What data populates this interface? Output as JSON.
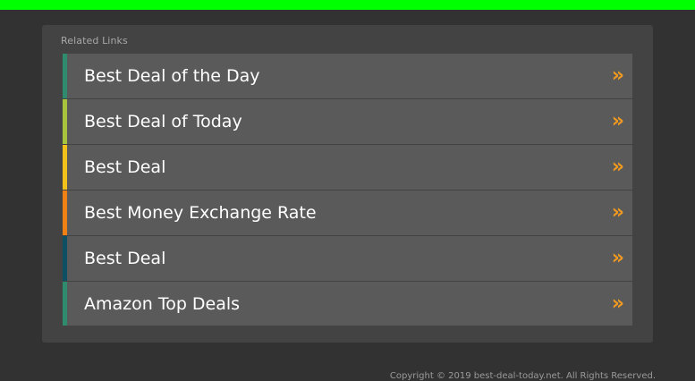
{
  "panel": {
    "title": "Related Links"
  },
  "links": [
    {
      "label": "Best Deal of the Day",
      "accent": "#2e8b6e"
    },
    {
      "label": "Best Deal of Today",
      "accent": "#a8c43c"
    },
    {
      "label": "Best Deal",
      "accent": "#f2c21b"
    },
    {
      "label": "Best Money Exchange Rate",
      "accent": "#f07f14"
    },
    {
      "label": "Best Deal",
      "accent": "#0d4f63"
    },
    {
      "label": "Amazon Top Deals",
      "accent": "#2e8b6e"
    }
  ],
  "arrow_glyph": "»",
  "arrow_icon": "double-chevron-right-icon",
  "colors": {
    "top_bar": "#00ff00",
    "background": "#323232",
    "panel": "#434343",
    "row": "#5a5a5a",
    "arrow": "#f29a1f"
  },
  "footer": {
    "copyright": "Copyright © 2019 best-deal-today.net. All Rights Reserved."
  }
}
